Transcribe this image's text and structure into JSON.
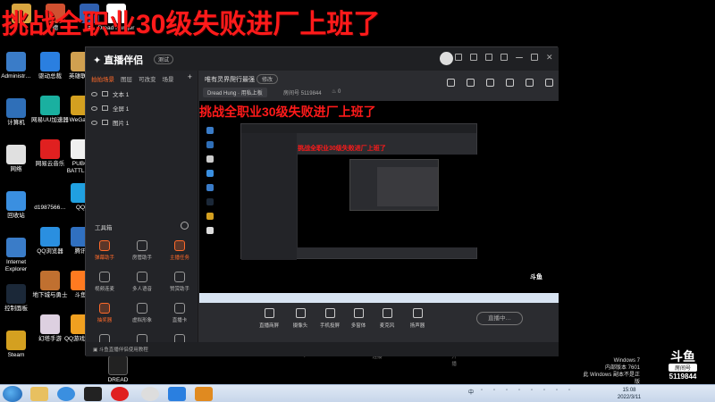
{
  "overlay_title": "挑战全职业30级失败进厂上班了",
  "desktop_icons": [
    {
      "label": "Administr…",
      "color": "#d9a640"
    },
    {
      "label": "计算机",
      "color": "#3a7cc8"
    },
    {
      "label": "网络",
      "color": "#2f6fb8"
    },
    {
      "label": "回收站",
      "color": "#e0e0e0"
    },
    {
      "label": "Internet Explorer",
      "color": "#3a8fe0"
    },
    {
      "label": "控制面板",
      "color": "#3a7cc8"
    },
    {
      "label": "Steam",
      "color": "#1b2838"
    },
    {
      "label": "WeGame",
      "color": "#d4a020"
    }
  ],
  "desktop_icons_col2": [
    {
      "label": "驱动总裁",
      "color": "#2a7fe0"
    },
    {
      "label": "网易UU加速器",
      "color": "#1ab0a0"
    },
    {
      "label": "网易云音乐",
      "color": "#e02020"
    },
    {
      "label": "d1987566…",
      "color": "#000000"
    },
    {
      "label": "QQ浏览器",
      "color": "#2a8fe0"
    },
    {
      "label": "地下城与勇士",
      "color": "#c07030"
    },
    {
      "label": "幻塔手游",
      "color": "#ddd0e0"
    }
  ],
  "desktop_icons_col3": [
    {
      "label": "英雄联盟",
      "color": "#d0a050"
    },
    {
      "label": "WeGa…",
      "color": "#d4a020"
    },
    {
      "label": "PUBG BATTLE…",
      "color": "#f0f0f0"
    },
    {
      "label": "QQ",
      "color": "#20a0e0"
    },
    {
      "label": "腾讯",
      "color": "#3070c0"
    },
    {
      "label": "斗鱼",
      "color": "#ff7a20"
    },
    {
      "label": "QQ游戏官网",
      "color": "#f0a020"
    }
  ],
  "top_icons": [
    {
      "label": "德",
      "color": "#d05030"
    },
    {
      "label": "手",
      "color": "#3060b0"
    },
    {
      "label": "Dread Hunger",
      "color": "#ffffff"
    }
  ],
  "dread_hunger_desktop": "DREAD HUNGER…",
  "app": {
    "logo": "直播伴侣",
    "badge": "测试",
    "tabs": [
      "拍拍场景",
      "图层",
      "可改变",
      "场景"
    ],
    "sources": [
      "文本 1",
      "全屏 1",
      "图片 1"
    ],
    "toolbox_title": "工具箱",
    "tools": [
      {
        "label": "弹幕助手",
        "orange": true
      },
      {
        "label": "房管助手",
        "orange": false
      },
      {
        "label": "主播任务",
        "orange": true
      },
      {
        "label": "视频连麦",
        "orange": false
      },
      {
        "label": "多人语音",
        "orange": false
      },
      {
        "label": "赞赏助手",
        "orange": false
      },
      {
        "label": "抽奖器",
        "orange": true
      },
      {
        "label": "虚拟形象",
        "orange": false
      },
      {
        "label": "直播卡",
        "orange": false
      },
      {
        "label": "",
        "orange": false
      },
      {
        "label": "",
        "orange": false
      },
      {
        "label": "",
        "orange": false
      }
    ],
    "bottom_tip": "斗鱼直播伴侣使用教程",
    "room_title": "唯有灵界爬行最强",
    "edit": "修改",
    "game": "Dread Hung",
    "game_suffix": "· 用私上板",
    "room_label": "房间号",
    "room_no": "5119844",
    "heat": "0",
    "preview_title": "挑战全职业30级失败进厂上班了",
    "preview_logo": "斗鱼",
    "controls": [
      "直播商屏",
      "摄像头",
      "手机投屏",
      "多窗体",
      "麦克风",
      "扬声器"
    ],
    "live_button": "直播中…",
    "stats": [
      "直播SMbps",
      "FPS:60",
      "直播连接",
      "CPU:34%",
      "未开播"
    ]
  },
  "win_info": {
    "line1": "Windows 7",
    "line2": "内部版本 7601",
    "line3": "此 Windows 副本不是正版"
  },
  "douyu": {
    "mark": "斗鱼",
    "tag": "房间号",
    "num": "5119844"
  },
  "taskbar": {
    "time": "15:08",
    "date": "2022/3/11",
    "ime": "中"
  }
}
